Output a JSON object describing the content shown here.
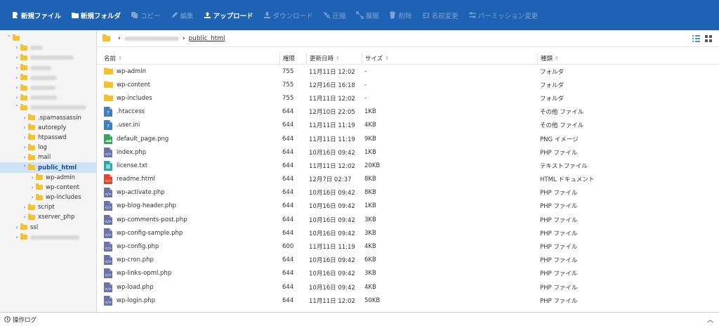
{
  "toolbar": {
    "new_file": "新規ファイル",
    "new_folder": "新規フォルダ",
    "copy": "コピー",
    "edit": "編集",
    "upload": "アップロード",
    "download": "ダウンロード",
    "compress": "圧縮",
    "extract": "展開",
    "delete": "削除",
    "rename": "名前変更",
    "permission": "パーミッション変更"
  },
  "breadcrumb": {
    "current": "public_html"
  },
  "tree": {
    "items": [
      {
        "label": "",
        "depth": 0,
        "chev": "˅",
        "blurred": true,
        "blur_w": 0
      },
      {
        "label": "",
        "depth": 1,
        "chev": "›",
        "blurred": true,
        "blur_w": 18
      },
      {
        "label": "",
        "depth": 1,
        "chev": "›",
        "blurred": true,
        "blur_w": 62
      },
      {
        "label": "",
        "depth": 1,
        "chev": "›",
        "blurred": true,
        "blur_w": 30
      },
      {
        "label": "",
        "depth": 1,
        "chev": "›",
        "blurred": true,
        "blur_w": 38
      },
      {
        "label": "",
        "depth": 1,
        "chev": "›",
        "blurred": true,
        "blur_w": 36
      },
      {
        "label": "",
        "depth": 1,
        "chev": "›",
        "blurred": true,
        "blur_w": 38
      },
      {
        "label": "",
        "depth": 1,
        "chev": "˅",
        "blurred": true,
        "blur_w": 80
      },
      {
        "label": ".spamassassin",
        "depth": 2,
        "chev": "›"
      },
      {
        "label": "autoreply",
        "depth": 2,
        "chev": "›"
      },
      {
        "label": "htpasswd",
        "depth": 2,
        "chev": "›"
      },
      {
        "label": "log",
        "depth": 2,
        "chev": "›"
      },
      {
        "label": "mail",
        "depth": 2,
        "chev": "›"
      },
      {
        "label": "public_html",
        "depth": 2,
        "chev": "˅",
        "selected": true
      },
      {
        "label": "wp-admin",
        "depth": 3,
        "chev": "›"
      },
      {
        "label": "wp-content",
        "depth": 3,
        "chev": "›"
      },
      {
        "label": "wp-includes",
        "depth": 3,
        "chev": "›"
      },
      {
        "label": "script",
        "depth": 2,
        "chev": "›"
      },
      {
        "label": "xserver_php",
        "depth": 2,
        "chev": "›"
      },
      {
        "label": "ssl",
        "depth": 1,
        "chev": "›"
      },
      {
        "label": "",
        "depth": 1,
        "chev": "›",
        "blurred": true,
        "blur_w": 70
      }
    ]
  },
  "table": {
    "headers": {
      "name": "名前",
      "perm": "権限",
      "date": "更新日時",
      "size": "サイズ",
      "type": "種類"
    },
    "rows": [
      {
        "name": "wp-admin",
        "icon": "folder",
        "perm": "755",
        "date": "11月11日 12:02",
        "size": "-",
        "type": "フォルダ"
      },
      {
        "name": "wp-content",
        "icon": "folder",
        "perm": "755",
        "date": "12月16日 16:18",
        "size": "-",
        "type": "フォルダ"
      },
      {
        "name": "wp-includes",
        "icon": "folder",
        "perm": "755",
        "date": "11月11日 12:02",
        "size": "-",
        "type": "フォルダ"
      },
      {
        "name": ".htaccess",
        "icon": "unknown",
        "perm": "644",
        "date": "12月10日 22:05",
        "size": "1KB",
        "type": "その他 ファイル"
      },
      {
        "name": ".user.ini",
        "icon": "unknown",
        "perm": "644",
        "date": "11月11日 11:19",
        "size": "4KB",
        "type": "その他 ファイル"
      },
      {
        "name": "default_page.png",
        "icon": "image",
        "perm": "644",
        "date": "11月11日 11:19",
        "size": "9KB",
        "type": "PNG イメージ"
      },
      {
        "name": "index.php",
        "icon": "php",
        "perm": "644",
        "date": "10月16日 09:42",
        "size": "1KB",
        "type": "PHP ファイル"
      },
      {
        "name": "license.txt",
        "icon": "text",
        "perm": "644",
        "date": "11月11日 12:02",
        "size": "20KB",
        "type": "テキストファイル"
      },
      {
        "name": "readme.html",
        "icon": "html",
        "perm": "644",
        "date": "12月7日 02:37",
        "size": "8KB",
        "type": "HTML ドキュメント"
      },
      {
        "name": "wp-activate.php",
        "icon": "php",
        "perm": "644",
        "date": "10月16日 09:42",
        "size": "8KB",
        "type": "PHP ファイル"
      },
      {
        "name": "wp-blog-header.php",
        "icon": "php",
        "perm": "644",
        "date": "10月16日 09:42",
        "size": "1KB",
        "type": "PHP ファイル"
      },
      {
        "name": "wp-comments-post.php",
        "icon": "php",
        "perm": "644",
        "date": "10月16日 09:42",
        "size": "3KB",
        "type": "PHP ファイル"
      },
      {
        "name": "wp-config-sample.php",
        "icon": "php",
        "perm": "644",
        "date": "10月16日 09:42",
        "size": "3KB",
        "type": "PHP ファイル"
      },
      {
        "name": "wp-config.php",
        "icon": "php",
        "perm": "600",
        "date": "11月11日 11:19",
        "size": "4KB",
        "type": "PHP ファイル"
      },
      {
        "name": "wp-cron.php",
        "icon": "php",
        "perm": "644",
        "date": "10月16日 09:42",
        "size": "6KB",
        "type": "PHP ファイル"
      },
      {
        "name": "wp-links-opml.php",
        "icon": "php",
        "perm": "644",
        "date": "10月16日 09:42",
        "size": "3KB",
        "type": "PHP ファイル"
      },
      {
        "name": "wp-load.php",
        "icon": "php",
        "perm": "644",
        "date": "10月16日 09:42",
        "size": "4KB",
        "type": "PHP ファイル"
      },
      {
        "name": "wp-login.php",
        "icon": "php",
        "perm": "644",
        "date": "11月11日 12:02",
        "size": "50KB",
        "type": "PHP ファイル"
      }
    ]
  },
  "footer": {
    "log_label": "操作ログ"
  },
  "colors": {
    "toolbar": "#1e62b4",
    "folder": "#f2c230",
    "php": "#6a74a8",
    "unknown": "#3f7fc0",
    "text": "#2ea7a8",
    "html": "#e0452f",
    "image": "#3aa657",
    "selected": "#cfe2f6"
  }
}
